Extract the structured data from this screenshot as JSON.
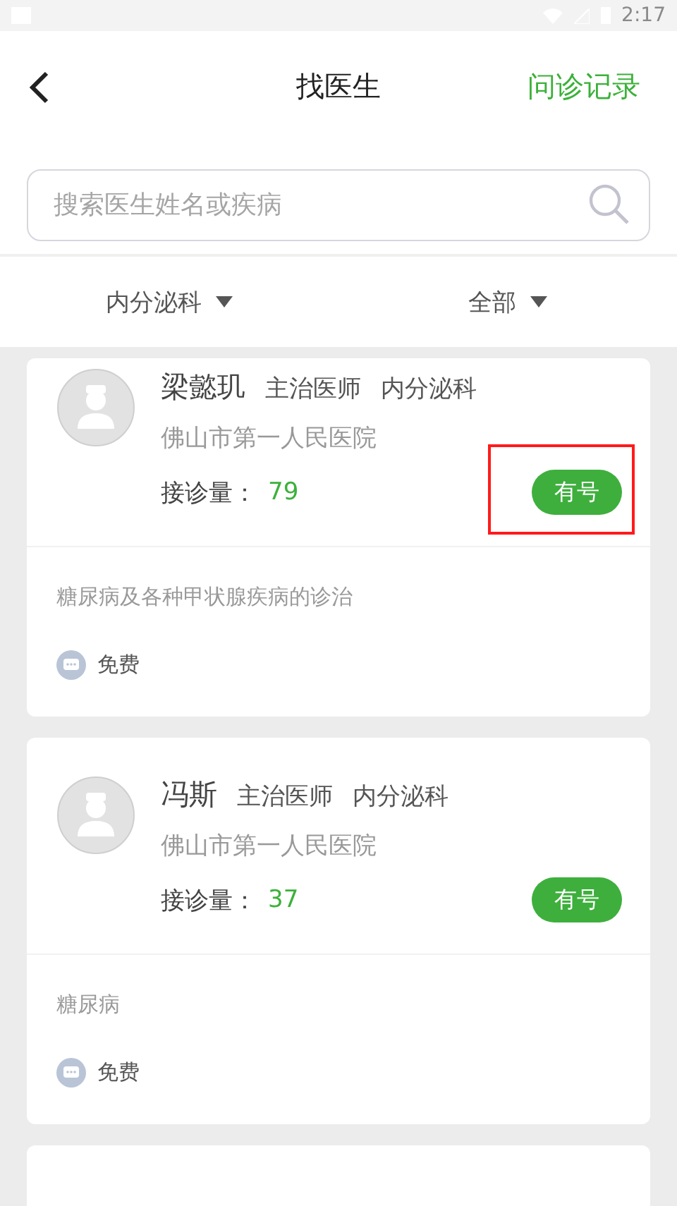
{
  "status_bar": {
    "time": "2:17"
  },
  "header": {
    "title": "找医生",
    "action": "问诊记录"
  },
  "search": {
    "placeholder": "搜索医生姓名或疾病"
  },
  "filters": [
    {
      "label": "内分泌科"
    },
    {
      "label": "全部"
    }
  ],
  "doctors": [
    {
      "name": "梁懿玑",
      "title": "主治医师",
      "department": "内分泌科",
      "hospital": "佛山市第一人民医院",
      "count_label": "接诊量：",
      "count": "79",
      "availability": "有号",
      "highlighted": true,
      "specialty": "糖尿病及各种甲状腺疾病的诊治",
      "fee": "免费"
    },
    {
      "name": "冯斯",
      "title": "主治医师",
      "department": "内分泌科",
      "hospital": "佛山市第一人民医院",
      "count_label": "接诊量：",
      "count": "37",
      "availability": "有号",
      "highlighted": false,
      "specialty": "糖尿病",
      "fee": "免费"
    }
  ]
}
